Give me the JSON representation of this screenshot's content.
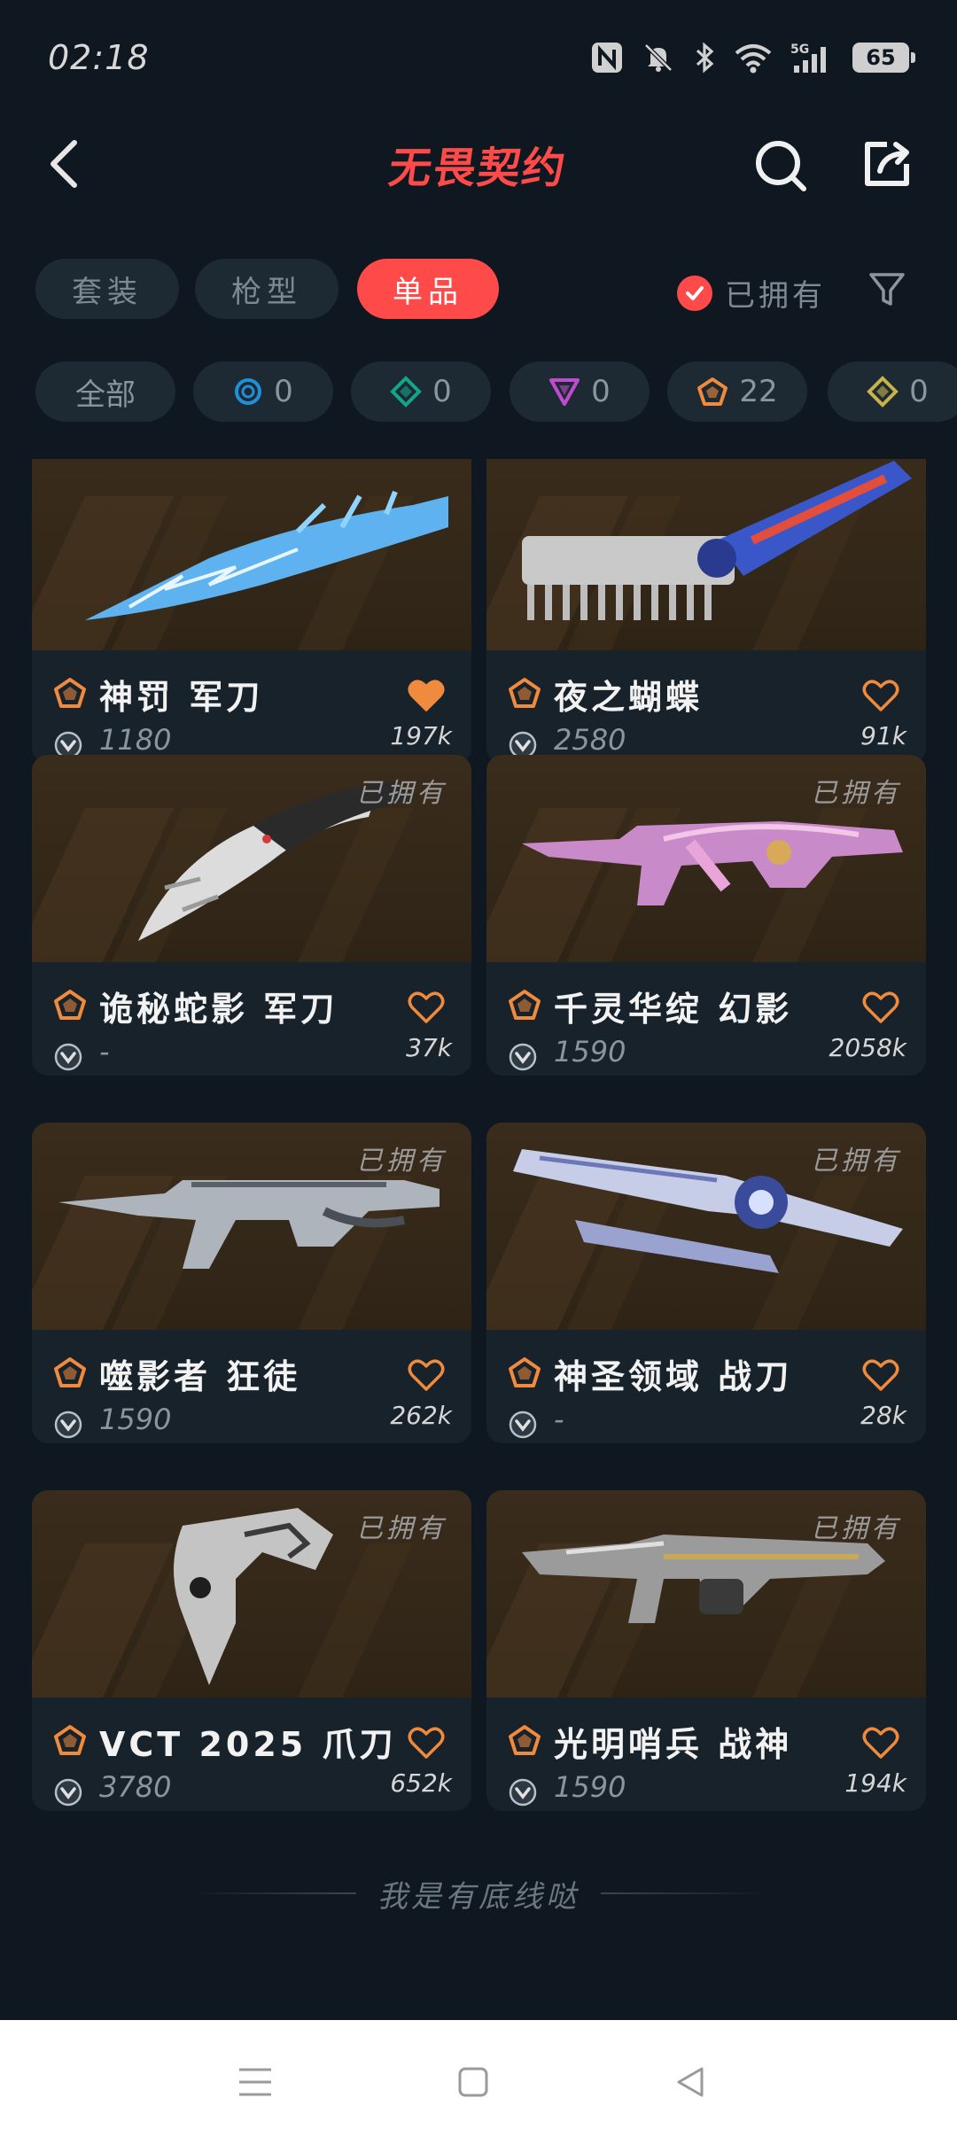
{
  "status_bar": {
    "time": "02:18",
    "battery": "65"
  },
  "header": {
    "title": "无畏契约"
  },
  "tabs": [
    {
      "label": "套装",
      "active": false
    },
    {
      "label": "枪型",
      "active": false
    },
    {
      "label": "单品",
      "active": true
    }
  ],
  "owned_toggle": {
    "label": "已拥有",
    "checked": true
  },
  "tier_filters": [
    {
      "label": "全部",
      "icon": "all",
      "count": ""
    },
    {
      "label": "",
      "icon": "select-tier-icon",
      "count": "0",
      "color": "#1f8fd6"
    },
    {
      "label": "",
      "icon": "deluxe-tier-icon",
      "count": "0",
      "color": "#12a58c"
    },
    {
      "label": "",
      "icon": "premium-tier-icon",
      "count": "0",
      "color": "#c04bd0"
    },
    {
      "label": "",
      "icon": "exclusive-tier-icon",
      "count": "22",
      "color": "#f08a3c"
    },
    {
      "label": "",
      "icon": "ultra-tier-icon",
      "count": "0",
      "color": "#c8b34b"
    }
  ],
  "items": [
    {
      "name": "神罚 军刀",
      "price": "1180",
      "likes": "197k",
      "owned": false,
      "liked": true,
      "weapon": "lightning-knife-icon"
    },
    {
      "name": "夜之蝴蝶",
      "price": "2580",
      "likes": "91k",
      "owned": false,
      "liked": false,
      "weapon": "butterfly-knife-icon"
    },
    {
      "name": "诡秘蛇影 军刀",
      "price": "-",
      "likes": "37k",
      "owned": true,
      "owned_label": "已拥有",
      "liked": false,
      "weapon": "karambit-icon"
    },
    {
      "name": "千灵华绽 幻影",
      "price": "1590",
      "likes": "2058k",
      "owned": true,
      "owned_label": "已拥有",
      "liked": false,
      "weapon": "phantom-rifle-icon"
    },
    {
      "name": "噬影者 狂徒",
      "price": "1590",
      "likes": "262k",
      "owned": true,
      "owned_label": "已拥有",
      "liked": false,
      "weapon": "vandal-rifle-icon"
    },
    {
      "name": "神圣领域 战刀",
      "price": "-",
      "likes": "28k",
      "owned": true,
      "owned_label": "已拥有",
      "liked": false,
      "weapon": "sword-icon"
    },
    {
      "name": "VCT 2025 爪刀",
      "price": "3780",
      "likes": "652k",
      "owned": true,
      "owned_label": "已拥有",
      "liked": false,
      "weapon": "claw-knife-icon"
    },
    {
      "name": "光明哨兵 战神",
      "price": "1590",
      "likes": "194k",
      "owned": true,
      "owned_label": "已拥有",
      "liked": false,
      "weapon": "odin-gun-icon"
    }
  ],
  "footer": {
    "end_text": "我是有底线哒"
  },
  "colors": {
    "accent": "#ff4a4a",
    "background": "#0f1820",
    "card": "#17222b",
    "tier_exclusive": "#f08a3c",
    "heart": "#f08a3c"
  }
}
